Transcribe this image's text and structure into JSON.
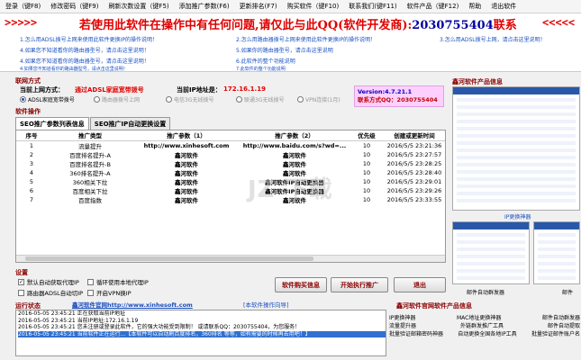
{
  "menu": [
    "登录（键F8)",
    "修改密码（键F9)",
    "刷新次数设置（键F5)",
    "添加推广参数(F6)",
    "更新排名(F7)",
    "购买软件（键F10)",
    "联系我们(键F11)",
    "软件产品（键F12)",
    "帮助",
    "退出软件"
  ],
  "banner": {
    "arrows_left": ">>>>>",
    "arrows_right": "<<<<<",
    "headline": "若使用此软件在操作中有任何问题,请仅此与此QQ(软件开发商):",
    "qq": "2030755404",
    "headline_suffix": "联系",
    "links": [
      "1.怎么用ADSL拨号上网来使用此软件更换IP的操作说明！",
      "2.怎么用路由器拨号上网来使用此软件更换IP的操作说明！",
      "3.怎么用ADSL拨号上网，请点击这里说明！",
      "4.如果您不知道看你的路由器型号，请点击这里说明！",
      "5.如果你的路由器型号，请点击这里说明",
      "4.如果您不知道看你的路由器型号，请点击这里说明！",
      "6.此软件的整个功能说明",
      "4.如果您不知道看你的路由器型号，请点击这里说明！",
      "7.此软件的整个功能说明"
    ]
  },
  "network": {
    "section_title": "联网方式",
    "current_mode_label": "当前上网方式：",
    "current_mode_value": "通过ADSL家庭宽带拨号",
    "ip_label": "当前IP地址是：",
    "ip_value": "172.16.1.19",
    "radios": [
      "ADSL家庭宽带拨号",
      "路由器拨号上网",
      "电信3G无线拨号",
      "联通3G无线拨号",
      "VPN连接(1月)"
    ]
  },
  "version": {
    "line1": "Version:4.7.21.1",
    "line2": "联系方式QQ：2030755404"
  },
  "ops": {
    "section_title": "软件操作",
    "tabs": [
      "SEO推广参数列表信息",
      "SEO推广IP自动更换设置"
    ],
    "columns": [
      "序号",
      "推广类型",
      "推广参数（1）",
      "推广参数（2）",
      "优先级",
      "创建或更新时间"
    ],
    "rows": [
      [
        "1",
        "流量提升",
        "http://www.xinhesoft.com",
        "http://www.baidu.com/s?wd=...",
        "10",
        "2016/5/5 23:21:36"
      ],
      [
        "2",
        "百度排名提升-A",
        "鑫河软件",
        "鑫河软件",
        "10",
        "2016/5/5 23:27:57"
      ],
      [
        "3",
        "百度排名提升-B",
        "鑫河软件",
        "鑫河软件",
        "10",
        "2016/5/5 23:28:25"
      ],
      [
        "4",
        "360排名提升-A",
        "鑫河软件",
        "鑫河软件",
        "10",
        "2016/5/5 23:28:40"
      ],
      [
        "5",
        "360相关下拉",
        "鑫河软件",
        "鑫河软件IP自动更换器",
        "10",
        "2016/5/5 23:29:01"
      ],
      [
        "6",
        "百度相关下拉",
        "鑫河软件",
        "鑫河软件IP自动更换器",
        "10",
        "2016/5/5 23:29:26"
      ],
      [
        "7",
        "百度指数",
        "鑫河软件",
        "鑫河软件",
        "10",
        "2016/5/5 23:33:55"
      ]
    ]
  },
  "settings": {
    "section_title": "设置",
    "checks": [
      {
        "label": "默认自动获取代理IP",
        "checked": true
      },
      {
        "label": "循环使用本地代理IP",
        "checked": false
      },
      {
        "label": "路由器ADSL自动切IP",
        "checked": false
      },
      {
        "label": "开启VPN换IP",
        "checked": false
      }
    ],
    "buttons": {
      "buy": "软件购买信息",
      "start": "开始执行推广",
      "exit": "退出"
    }
  },
  "status": {
    "section_title": "运行状态",
    "site_link": "鑫河软件官网http://www.xinhesoft.com",
    "help_link": "[本软件操作向导]",
    "log": [
      "2016-05-05 23:45:21 正在获取当前IP地址",
      "2016-05-05 23:45:21 当前IP地址:172.16.1.19",
      "2016-05-05 23:45:21 您未注册或登录此软件，它的强大功能受到限制！ 或请联系QQ：2030755404，为您服务！",
      "2016-05-05 23:45:21 当前软件正在运行...【本软件可以自动刷百度排名，360排名 等等，如有需要的时候再去用吧！】"
    ]
  },
  "right": {
    "title": "鑫河软件产品信息",
    "captions": [
      "IP更换神器",
      "邮件自动群发器",
      "邮件"
    ]
  },
  "products": {
    "title": "鑫河软件官网软件产品信息",
    "rows": [
      [
        "IP更换神器",
        "MAC地址更换神器",
        "邮件自动群发器"
      ],
      [
        "流量提升器",
        "外链群发推广工具",
        "邮件自动提取"
      ],
      [
        "批量验证邮箱密码神器",
        "自动更换全国各地IP工具",
        "批量验证邮件账户名"
      ]
    ]
  },
  "watermark": "JZ  下载"
}
